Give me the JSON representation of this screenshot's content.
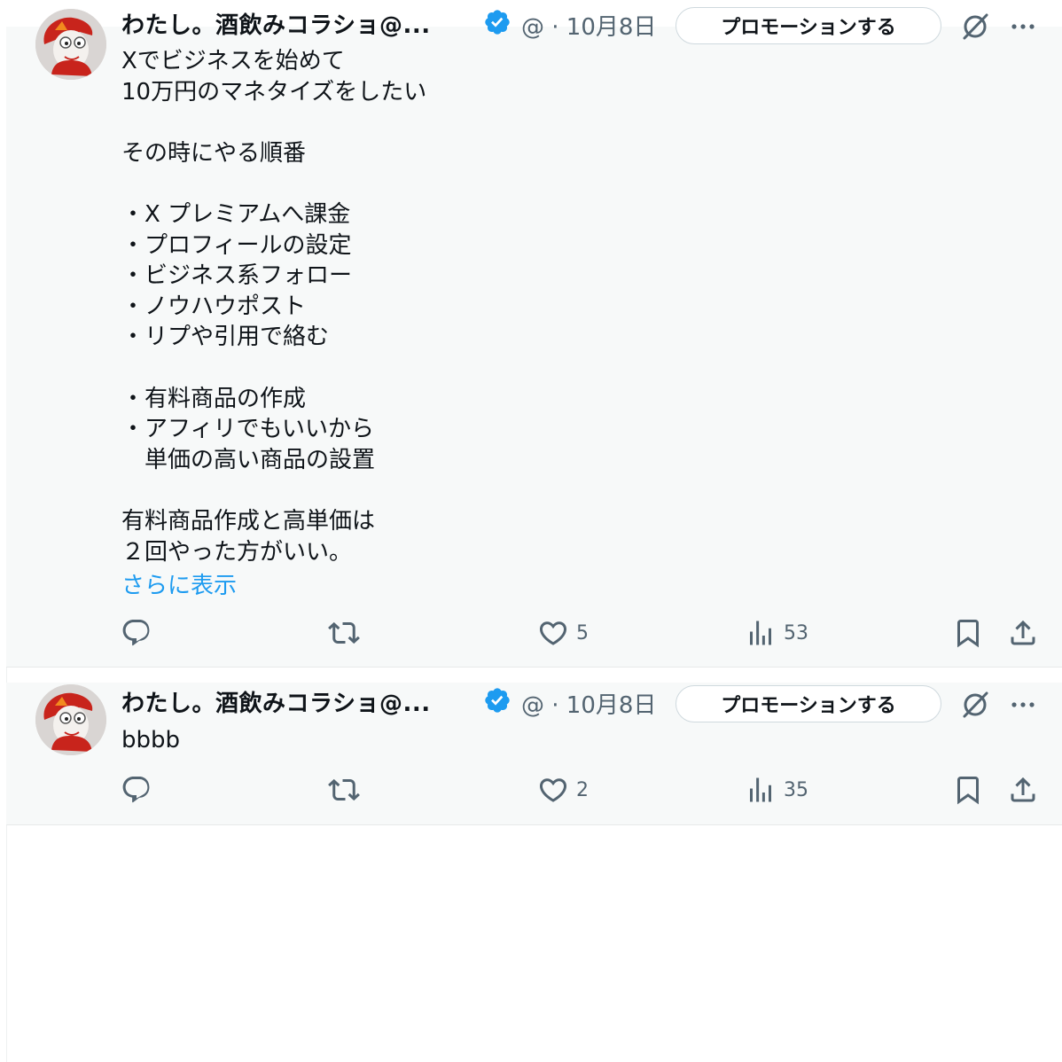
{
  "posts": [
    {
      "author": {
        "display_name": "わたし。酒飲みコラショ@...",
        "handle_time": "@ · 10月8日",
        "verified": true
      },
      "promote_label": "プロモーションする",
      "body": "Xでビジネスを始めて\n10万円のマネタイズをしたい\n\nその時にやる順番\n\n・X プレミアムへ課金\n・プロフィールの設定\n・ビジネス系フォロー\n・ノウハウポスト\n・リプや引用で絡む\n\n・有料商品の作成\n・アフィリでもいいから\n　単価の高い商品の設置\n\n有料商品作成と高単価は\n２回やった方がいい。",
      "show_more": "さらに表示",
      "actions": {
        "likes": "5",
        "views": "53"
      }
    },
    {
      "author": {
        "display_name": "わたし。酒飲みコラショ@...",
        "handle_time": "@ · 10月8日",
        "verified": true
      },
      "promote_label": "プロモーションする",
      "body": "bbbb",
      "actions": {
        "likes": "2",
        "views": "35"
      }
    }
  ],
  "icons": {
    "reply": "reply-icon",
    "repost": "repost-icon",
    "like": "heart-icon",
    "views": "views-icon",
    "bookmark": "bookmark-icon",
    "share": "share-icon",
    "grok": "grok-icon",
    "more": "more-icon",
    "verified": "verified-badge-icon"
  },
  "colors": {
    "verified": "#1d9bf0",
    "link": "#1d9bf0",
    "secondary_text": "#536471",
    "post_background": "#f7f9f9"
  }
}
